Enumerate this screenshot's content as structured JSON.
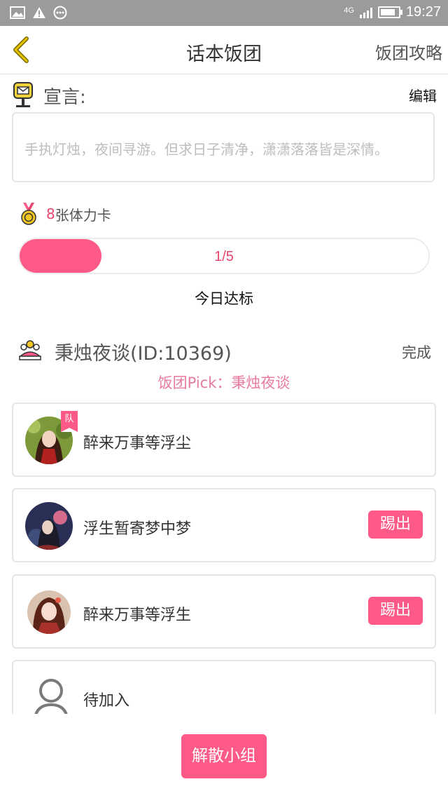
{
  "status_bar": {
    "network": "4G",
    "time": "19:27",
    "icons": [
      "image-icon",
      "warning-icon",
      "more-icon",
      "signal-icon",
      "battery-icon"
    ]
  },
  "nav": {
    "title": "话本饭团",
    "right_link": "饭团攻略",
    "back_icon": "chevron-left-icon"
  },
  "declaration": {
    "label": "宣言:",
    "edit_label": "编辑",
    "text": "手执灯烛，夜间寻游。但求日子清净，潇潇落落皆是深情。"
  },
  "stamina": {
    "count": "8",
    "text": "张体力卡"
  },
  "progress": {
    "current": 1,
    "total": 5,
    "text": "1/5",
    "fraction": 0.2,
    "label": "今日达标"
  },
  "team": {
    "name": "秉烛夜谈(ID:10369)",
    "status": "完成",
    "pick": "饭团Pick：秉烛夜谈"
  },
  "members": [
    {
      "name": "醉来万事等浮尘",
      "badge": "队"
    },
    {
      "name": "浮生暂寄梦中梦",
      "kick_label": "踢出"
    },
    {
      "name": "醉来万事等浮生",
      "kick_label": "踢出"
    },
    {
      "name": "待加入"
    }
  ],
  "footer": {
    "disband_label": "解散小组"
  },
  "colors": {
    "accent": "#fe5a87",
    "status_bar": "#9b9b9b",
    "back_icon": "#c8a000",
    "pick_text": "#e87aa0"
  }
}
